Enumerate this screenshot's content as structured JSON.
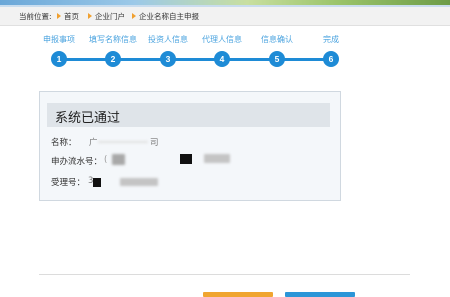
{
  "breadcrumb": {
    "lead": "当前位置:",
    "items": [
      "首页",
      "企业门户",
      "企业名称自主申报"
    ]
  },
  "steps": {
    "labels": [
      "申报事项",
      "填写名称信息",
      "投资人信息",
      "代理人信息",
      "信息确认",
      "完成"
    ],
    "numbers": [
      "1",
      "2",
      "3",
      "4",
      "5",
      "6"
    ]
  },
  "result": {
    "title": "系统已通过",
    "name_label": "名称：",
    "name_partial_start": "广",
    "name_partial_end": "司",
    "serial_label": "申办流水号：",
    "serial_partial": "(",
    "accept_label": "受理号：",
    "accept_partial": "3"
  },
  "colors": {
    "step_color": "#1e8bd6",
    "step_label": "#4aa3df",
    "button_primary": "#f0a530",
    "button_secondary": "#2b96d8",
    "breadcrumb_arrow": "#f0a030"
  }
}
